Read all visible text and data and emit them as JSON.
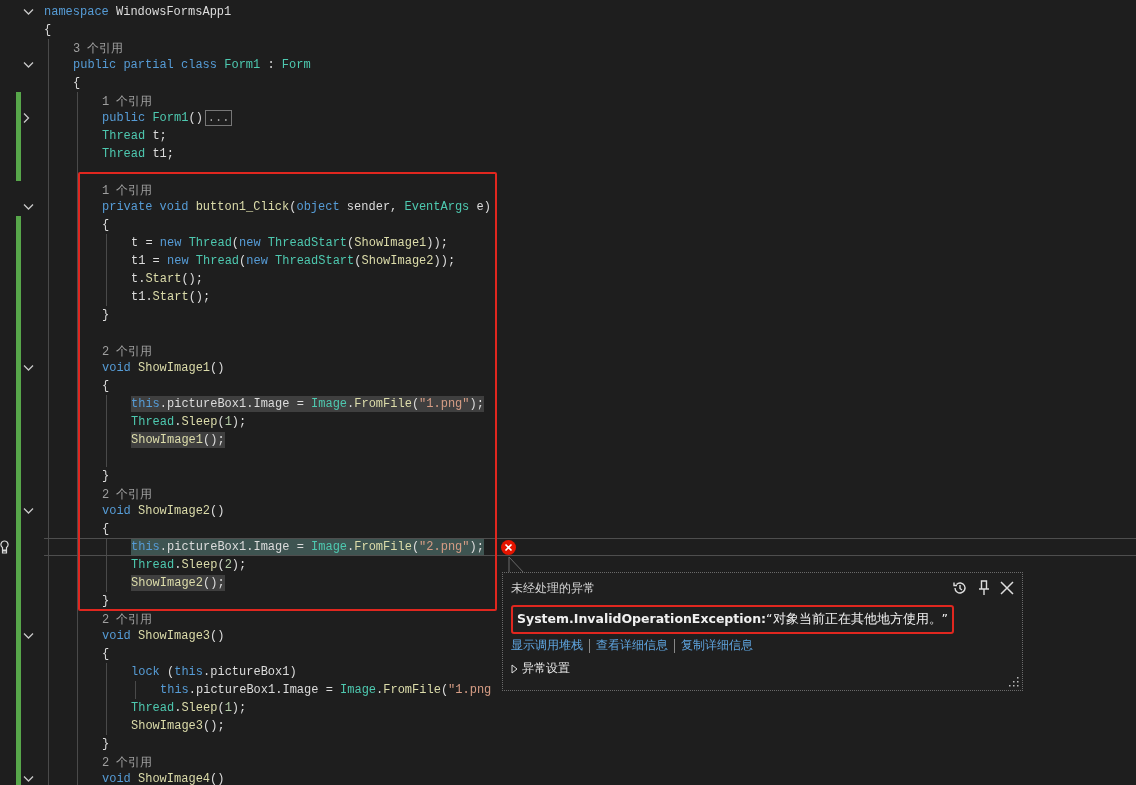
{
  "editor": {
    "lines": [
      {
        "kind": "code",
        "collapsed": false,
        "tokens": [
          {
            "kind": "kw",
            "text": "namespace"
          },
          {
            "kind": "plain",
            "text": " WindowsFormsApp1"
          }
        ]
      },
      {
        "kind": "code",
        "tokens": [
          {
            "kind": "plain",
            "text": "{"
          }
        ],
        "children": [
          {
            "kind": "lens",
            "text": "3 个引用"
          },
          {
            "kind": "code",
            "collapsed": false,
            "tokens": [
              {
                "kind": "kw",
                "text": "public partial class "
              },
              {
                "kind": "type",
                "text": "Form1"
              },
              {
                "kind": "plain",
                "text": " : "
              },
              {
                "kind": "type",
                "text": "Form"
              }
            ]
          },
          {
            "kind": "code",
            "tokens": [
              {
                "kind": "plain",
                "text": "{"
              }
            ],
            "children": [
              {
                "kind": "lens",
                "changed": true,
                "text": "1 个引用"
              },
              {
                "kind": "code",
                "changed": true,
                "collapsed": true,
                "tokens": [
                  {
                    "kind": "kw",
                    "text": "public "
                  },
                  {
                    "kind": "type",
                    "text": "Form1"
                  },
                  {
                    "kind": "plain",
                    "text": "()"
                  },
                  {
                    "kind": "ellipsis",
                    "text": "..."
                  }
                ]
              },
              {
                "kind": "code",
                "changed": true,
                "tokens": [
                  {
                    "kind": "type",
                    "text": "Thread"
                  },
                  {
                    "kind": "plain",
                    "text": " t;"
                  }
                ]
              },
              {
                "kind": "code",
                "changed": true,
                "tokens": [
                  {
                    "kind": "type",
                    "text": "Thread"
                  },
                  {
                    "kind": "plain",
                    "text": " t1;"
                  }
                ]
              },
              {
                "kind": "blank",
                "changed": true
              },
              {
                "kind": "lens",
                "text": "1 个引用"
              },
              {
                "kind": "code",
                "collapsed": false,
                "tokens": [
                  {
                    "kind": "kw",
                    "text": "private void "
                  },
                  {
                    "kind": "method",
                    "text": "button1_Click"
                  },
                  {
                    "kind": "plain",
                    "text": "("
                  },
                  {
                    "kind": "kw",
                    "text": "object"
                  },
                  {
                    "kind": "plain",
                    "text": " sender, "
                  },
                  {
                    "kind": "type",
                    "text": "EventArgs"
                  },
                  {
                    "kind": "plain",
                    "text": " e)"
                  }
                ]
              },
              {
                "kind": "code",
                "changed": true,
                "tokens": [
                  {
                    "kind": "plain",
                    "text": "{"
                  }
                ],
                "children": [
                  {
                    "kind": "code",
                    "changed": true,
                    "tokens": [
                      {
                        "kind": "plain",
                        "text": "t = "
                      },
                      {
                        "kind": "kw",
                        "text": "new "
                      },
                      {
                        "kind": "type",
                        "text": "Thread"
                      },
                      {
                        "kind": "plain",
                        "text": "("
                      },
                      {
                        "kind": "kw",
                        "text": "new "
                      },
                      {
                        "kind": "type",
                        "text": "ThreadStart"
                      },
                      {
                        "kind": "plain",
                        "text": "("
                      },
                      {
                        "kind": "method",
                        "text": "ShowImage1"
                      },
                      {
                        "kind": "plain",
                        "text": "));"
                      }
                    ]
                  },
                  {
                    "kind": "code",
                    "changed": true,
                    "tokens": [
                      {
                        "kind": "plain",
                        "text": "t1 = "
                      },
                      {
                        "kind": "kw",
                        "text": "new "
                      },
                      {
                        "kind": "type",
                        "text": "Thread"
                      },
                      {
                        "kind": "plain",
                        "text": "("
                      },
                      {
                        "kind": "kw",
                        "text": "new "
                      },
                      {
                        "kind": "type",
                        "text": "ThreadStart"
                      },
                      {
                        "kind": "plain",
                        "text": "("
                      },
                      {
                        "kind": "method",
                        "text": "ShowImage2"
                      },
                      {
                        "kind": "plain",
                        "text": "));"
                      }
                    ]
                  },
                  {
                    "kind": "code",
                    "changed": true,
                    "tokens": [
                      {
                        "kind": "plain",
                        "text": "t."
                      },
                      {
                        "kind": "method",
                        "text": "Start"
                      },
                      {
                        "kind": "plain",
                        "text": "();"
                      }
                    ]
                  },
                  {
                    "kind": "code",
                    "changed": true,
                    "tokens": [
                      {
                        "kind": "plain",
                        "text": "t1."
                      },
                      {
                        "kind": "method",
                        "text": "Start"
                      },
                      {
                        "kind": "plain",
                        "text": "();"
                      }
                    ]
                  }
                ]
              },
              {
                "kind": "code",
                "changed": true,
                "tokens": [
                  {
                    "kind": "plain",
                    "text": "}"
                  }
                ]
              },
              {
                "kind": "blank",
                "changed": true
              },
              {
                "kind": "lens",
                "changed": true,
                "text": "2 个引用"
              },
              {
                "kind": "code",
                "changed": true,
                "collapsed": false,
                "tokens": [
                  {
                    "kind": "kw",
                    "text": "void "
                  },
                  {
                    "kind": "method",
                    "text": "ShowImage1"
                  },
                  {
                    "kind": "plain",
                    "text": "()"
                  }
                ]
              },
              {
                "kind": "code",
                "changed": true,
                "tokens": [
                  {
                    "kind": "plain",
                    "text": "{"
                  }
                ],
                "children": [
                  {
                    "kind": "code",
                    "changed": true,
                    "highlighted": true,
                    "tokens": [
                      {
                        "kind": "kw",
                        "text": "this"
                      },
                      {
                        "kind": "plain",
                        "text": ".pictureBox1.Image = "
                      },
                      {
                        "kind": "type",
                        "text": "Image"
                      },
                      {
                        "kind": "plain",
                        "text": "."
                      },
                      {
                        "kind": "method",
                        "text": "FromFile"
                      },
                      {
                        "kind": "plain",
                        "text": "("
                      },
                      {
                        "kind": "str",
                        "text": "\"1.png\""
                      },
                      {
                        "kind": "plain",
                        "text": ");"
                      }
                    ]
                  },
                  {
                    "kind": "code",
                    "changed": true,
                    "tokens": [
                      {
                        "kind": "type",
                        "text": "Thread"
                      },
                      {
                        "kind": "plain",
                        "text": "."
                      },
                      {
                        "kind": "method",
                        "text": "Sleep"
                      },
                      {
                        "kind": "plain",
                        "text": "("
                      },
                      {
                        "kind": "num",
                        "text": "1"
                      },
                      {
                        "kind": "plain",
                        "text": ");"
                      }
                    ]
                  },
                  {
                    "kind": "code",
                    "changed": true,
                    "highlighted": true,
                    "tokens": [
                      {
                        "kind": "method",
                        "text": "ShowImage1"
                      },
                      {
                        "kind": "plain",
                        "text": "();"
                      }
                    ]
                  },
                  {
                    "kind": "blank",
                    "changed": true
                  }
                ]
              },
              {
                "kind": "code",
                "changed": true,
                "tokens": [
                  {
                    "kind": "plain",
                    "text": "}"
                  }
                ]
              },
              {
                "kind": "lens",
                "changed": true,
                "text": "2 个引用"
              },
              {
                "kind": "code",
                "changed": true,
                "collapsed": false,
                "tokens": [
                  {
                    "kind": "kw",
                    "text": "void "
                  },
                  {
                    "kind": "method",
                    "text": "ShowImage2"
                  },
                  {
                    "kind": "plain",
                    "text": "()"
                  }
                ]
              },
              {
                "kind": "code",
                "changed": true,
                "tokens": [
                  {
                    "kind": "plain",
                    "text": "{"
                  }
                ],
                "children": [
                  {
                    "kind": "code",
                    "changed": true,
                    "current": true,
                    "lightbulb": true,
                    "error": true,
                    "tokens": [
                      {
                        "kind": "kw",
                        "text": "this"
                      },
                      {
                        "kind": "plain",
                        "text": ".pictureBox1.Image = "
                      },
                      {
                        "kind": "type",
                        "text": "Image"
                      },
                      {
                        "kind": "plain",
                        "text": "."
                      },
                      {
                        "kind": "method",
                        "text": "FromFile"
                      },
                      {
                        "kind": "plain",
                        "text": "("
                      },
                      {
                        "kind": "str",
                        "text": "\"2.png\""
                      },
                      {
                        "kind": "plain",
                        "text": ");"
                      }
                    ]
                  },
                  {
                    "kind": "code",
                    "changed": true,
                    "tokens": [
                      {
                        "kind": "type",
                        "text": "Thread"
                      },
                      {
                        "kind": "plain",
                        "text": "."
                      },
                      {
                        "kind": "method",
                        "text": "Sleep"
                      },
                      {
                        "kind": "plain",
                        "text": "("
                      },
                      {
                        "kind": "num",
                        "text": "2"
                      },
                      {
                        "kind": "plain",
                        "text": ");"
                      }
                    ]
                  },
                  {
                    "kind": "code",
                    "changed": true,
                    "highlighted": true,
                    "tokens": [
                      {
                        "kind": "method",
                        "text": "ShowImage2"
                      },
                      {
                        "kind": "plain",
                        "text": "();"
                      }
                    ]
                  }
                ]
              },
              {
                "kind": "code",
                "changed": true,
                "tokens": [
                  {
                    "kind": "plain",
                    "text": "}"
                  }
                ]
              },
              {
                "kind": "lens",
                "changed": true,
                "text": "2 个引用"
              },
              {
                "kind": "code",
                "changed": true,
                "collapsed": false,
                "tokens": [
                  {
                    "kind": "kw",
                    "text": "void "
                  },
                  {
                    "kind": "method",
                    "text": "ShowImage3"
                  },
                  {
                    "kind": "plain",
                    "text": "()"
                  }
                ]
              },
              {
                "kind": "code",
                "changed": true,
                "tokens": [
                  {
                    "kind": "plain",
                    "text": "{"
                  }
                ],
                "children": [
                  {
                    "kind": "code",
                    "changed": true,
                    "tokens": [
                      {
                        "kind": "kw",
                        "text": "lock"
                      },
                      {
                        "kind": "plain",
                        "text": " ("
                      },
                      {
                        "kind": "kw",
                        "text": "this"
                      },
                      {
                        "kind": "plain",
                        "text": ".pictureBox1)"
                      }
                    ],
                    "children": [
                      {
                        "kind": "code",
                        "changed": true,
                        "tokens": [
                          {
                            "kind": "kw",
                            "text": "this"
                          },
                          {
                            "kind": "plain",
                            "text": ".pictureBox1.Image = "
                          },
                          {
                            "kind": "type",
                            "text": "Image"
                          },
                          {
                            "kind": "plain",
                            "text": "."
                          },
                          {
                            "kind": "method",
                            "text": "FromFile"
                          },
                          {
                            "kind": "plain",
                            "text": "("
                          },
                          {
                            "kind": "str",
                            "text": "\"1.png"
                          }
                        ]
                      }
                    ]
                  },
                  {
                    "kind": "code",
                    "changed": true,
                    "tokens": [
                      {
                        "kind": "type",
                        "text": "Thread"
                      },
                      {
                        "kind": "plain",
                        "text": "."
                      },
                      {
                        "kind": "method",
                        "text": "Sleep"
                      },
                      {
                        "kind": "plain",
                        "text": "("
                      },
                      {
                        "kind": "num",
                        "text": "1"
                      },
                      {
                        "kind": "plain",
                        "text": ");"
                      }
                    ]
                  },
                  {
                    "kind": "code",
                    "changed": true,
                    "tokens": [
                      {
                        "kind": "method",
                        "text": "ShowImage3"
                      },
                      {
                        "kind": "plain",
                        "text": "();"
                      }
                    ]
                  }
                ]
              },
              {
                "kind": "code",
                "changed": true,
                "tokens": [
                  {
                    "kind": "plain",
                    "text": "}"
                  }
                ]
              },
              {
                "kind": "lens",
                "changed": true,
                "text": "2 个引用"
              },
              {
                "kind": "code",
                "changed": true,
                "collapsed": false,
                "tokens": [
                  {
                    "kind": "kw",
                    "text": "void "
                  },
                  {
                    "kind": "method",
                    "text": "ShowImage4"
                  },
                  {
                    "kind": "plain",
                    "text": "()"
                  }
                ]
              }
            ]
          }
        ]
      }
    ]
  },
  "exception": {
    "title": "未经处理的异常",
    "message": "**System.InvalidOperationException:**“对象当前正在其他地方使用。”",
    "links": [
      "显示调用堆栈",
      "查看详细信息",
      "复制详细信息"
    ],
    "settings": {
      "label": "异常设置",
      "expanded": false
    }
  }
}
